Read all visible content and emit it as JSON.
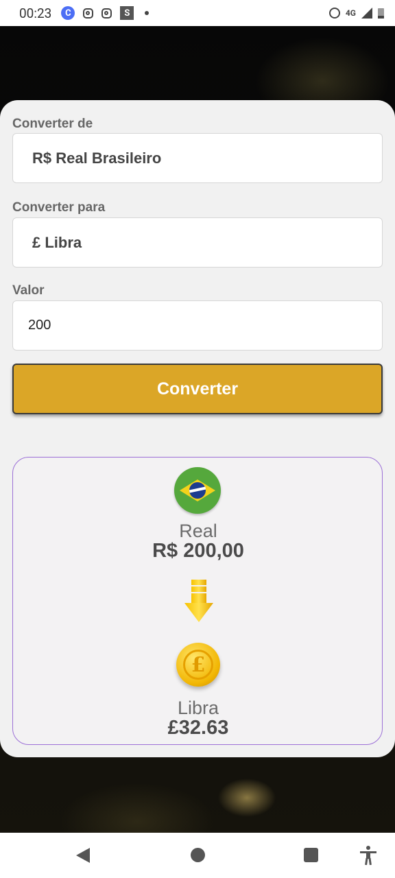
{
  "status_bar": {
    "time": "00:23",
    "network": "4G",
    "icons": [
      "c-app-icon",
      "instagram-icon",
      "instagram-icon",
      "s-app-icon",
      "dot-icon",
      "alarm-icon",
      "signal-icon",
      "battery-icon"
    ]
  },
  "form": {
    "from_label": "Converter de",
    "from_value": "R$ Real Brasileiro",
    "to_label": "Converter para",
    "to_value": "£ Libra",
    "amount_label": "Valor",
    "amount_value": "200",
    "convert_button": "Converter"
  },
  "result": {
    "from_name": "Real",
    "from_amount": "R$ 200,00",
    "to_name": "Libra",
    "to_amount": "£32.63"
  },
  "colors": {
    "button": "#dba627",
    "result_border": "#9b6fd6"
  }
}
